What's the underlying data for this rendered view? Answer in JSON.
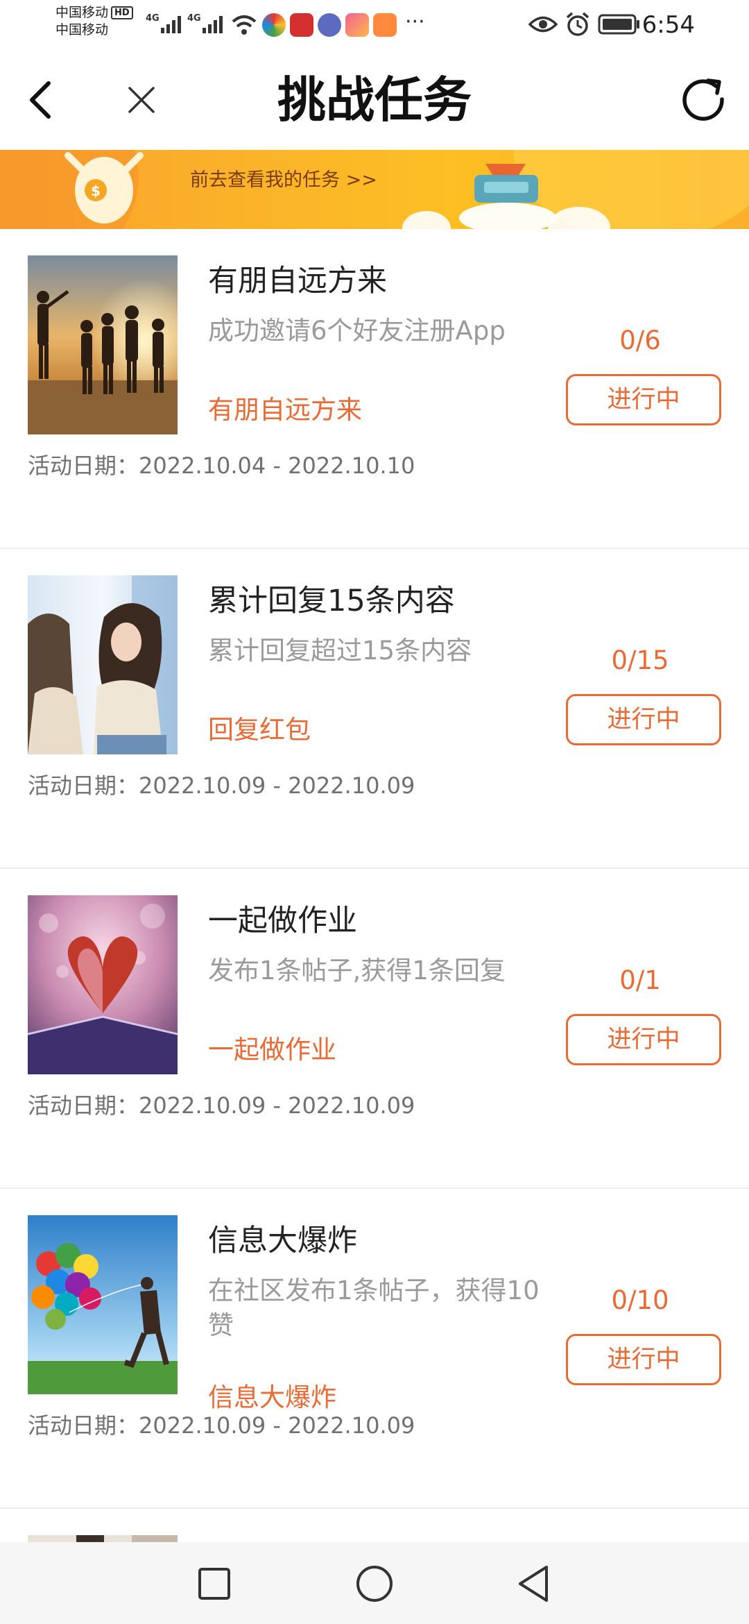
{
  "status_bar": {
    "carrier_top": "中国移动",
    "carrier_bottom": "中国移动",
    "hd_label": "HD",
    "net_1": "4G",
    "net_2": "4G",
    "more": "···",
    "time": "6:54"
  },
  "nav": {
    "title": "挑战任务"
  },
  "banner": {
    "link_text": "前去查看我的任务 >>"
  },
  "tasks": [
    {
      "title": "有朋自远方来",
      "desc": "成功邀请6个好友注册App",
      "tag": "有朋自远方来",
      "progress": "0/6",
      "status": "进行中",
      "date": "活动日期：2022.10.04 - 2022.10.10"
    },
    {
      "title": "累计回复15条内容",
      "desc": "累计回复超过15条内容",
      "tag": "回复红包",
      "progress": "0/15",
      "status": "进行中",
      "date": "活动日期：2022.10.09 - 2022.10.09"
    },
    {
      "title": "一起做作业",
      "desc": "发布1条帖子,获得1条回复",
      "tag": "一起做作业",
      "progress": "0/1",
      "status": "进行中",
      "date": "活动日期：2022.10.09 - 2022.10.09"
    },
    {
      "title": "信息大爆炸",
      "desc": "在社区发布1条帖子，获得10赞",
      "tag": "信息大爆炸",
      "progress": "0/10",
      "status": "进行中",
      "date": "活动日期：2022.10.09 - 2022.10.09"
    }
  ],
  "colors": {
    "accent": "#ea6a33",
    "banner": "#fbb429"
  },
  "icons": {
    "back": "chevron-left-icon",
    "close": "close-icon",
    "refresh": "refresh-icon",
    "recents": "square-icon",
    "home": "circle-icon",
    "system_back": "triangle-back-icon"
  }
}
